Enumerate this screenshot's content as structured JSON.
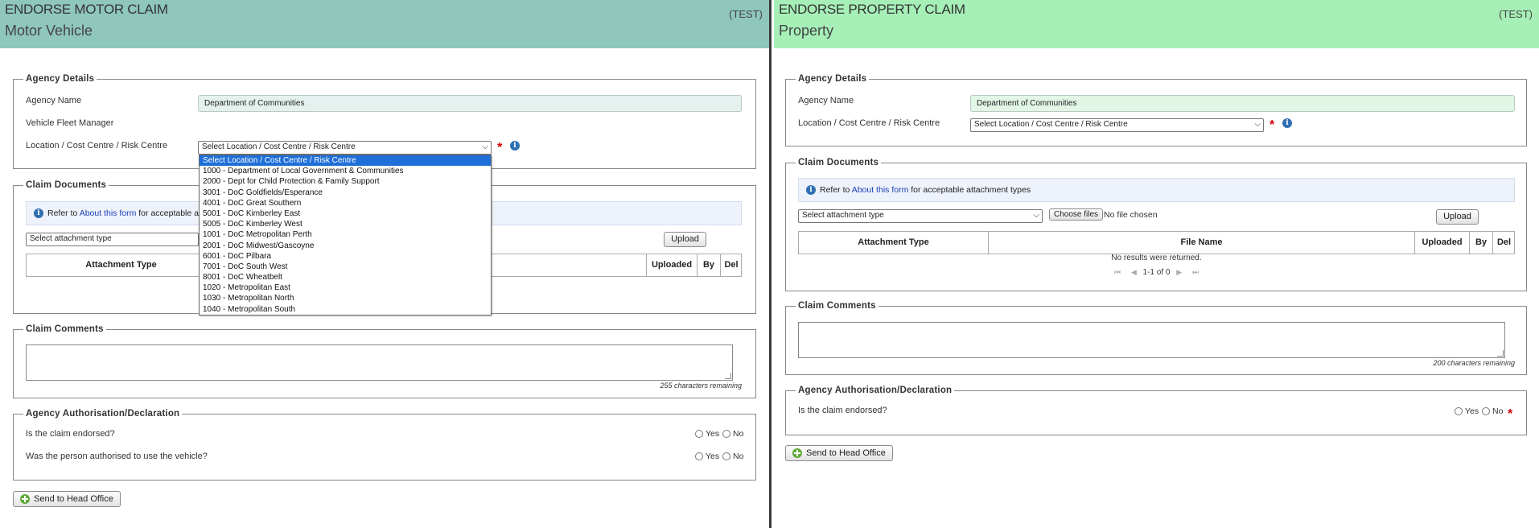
{
  "motor": {
    "title": "ENDORSE MOTOR CLAIM",
    "subtitle": "Motor Vehicle",
    "tag": "(TEST)",
    "agency_details": {
      "legend": "Agency Details",
      "agency_name_label": "Agency Name",
      "agency_name_value": "Department of Communities",
      "fleet_manager_label": "Vehicle Fleet Manager",
      "location_label": "Location / Cost Centre / Risk Centre",
      "location_selected": "Select Location / Cost Centre / Risk Centre"
    },
    "dropdown_options": [
      "Select Location / Cost Centre / Risk Centre",
      "1000 - Department of Local Government & Communities",
      "2000 - Dept for Child Protection & Family Support",
      "3001 - DoC Goldfields/Esperance",
      "4001 - DoC Great Southern",
      "5001 - DoC Kimberley East",
      "5005 - DoC Kimberley West",
      "1001 - DoC Metropolitan Perth",
      "2001 - DoC Midwest/Gascoyne",
      "6001 - DoC Pilbara",
      "7001 - DoC South West",
      "8001 - DoC Wheatbelt",
      "1020 - Metropolitan East",
      "1030 - Metropolitan North",
      "1040 - Metropolitan South"
    ],
    "claim_documents": {
      "legend": "Claim Documents",
      "info_prefix": "Refer to",
      "info_link": "About this form",
      "info_suffix": "for acceptable attach",
      "attachment_select": "Select attachment type",
      "upload_label": "Upload",
      "columns": [
        "Attachment Type",
        "Uploaded",
        "By",
        "Del"
      ]
    },
    "claim_comments": {
      "legend": "Claim Comments",
      "remaining": "255 characters remaining"
    },
    "authorisation": {
      "legend": "Agency Authorisation/Declaration",
      "q1": "Is the claim endorsed?",
      "q2": "Was the person authorised to use the vehicle?",
      "yes": "Yes",
      "no": "No"
    },
    "send_label": "Send to Head Office"
  },
  "property": {
    "title": "ENDORSE PROPERTY CLAIM",
    "subtitle": "Property",
    "tag": "(TEST)",
    "agency_details": {
      "legend": "Agency Details",
      "agency_name_label": "Agency Name",
      "agency_name_value": "Department of Communities",
      "location_label": "Location / Cost Centre / Risk Centre",
      "location_selected": "Select Location / Cost Centre / Risk Centre"
    },
    "claim_documents": {
      "legend": "Claim Documents",
      "info_prefix": "Refer to",
      "info_link": "About this form",
      "info_suffix": "for acceptable attachment types",
      "attachment_select": "Select attachment type",
      "choose_files": "Choose files",
      "no_file": "No file chosen",
      "upload_label": "Upload",
      "columns": [
        "Attachment Type",
        "File Name",
        "Uploaded",
        "By",
        "Del"
      ],
      "no_results": "No results were returned.",
      "pager": "1-1 of 0"
    },
    "claim_comments": {
      "legend": "Claim Comments",
      "remaining": "200 characters remaining"
    },
    "authorisation": {
      "legend": "Agency Authorisation/Declaration",
      "q1": "Is the claim endorsed?",
      "yes": "Yes",
      "no": "No"
    },
    "send_label": "Send to Head Office"
  },
  "colors": {
    "motor_header": "#8fc7bd",
    "property_header": "#a6f0b8",
    "selected_option": "#1f6fd8",
    "required": "#d50000",
    "link": "#1a3fb8"
  }
}
